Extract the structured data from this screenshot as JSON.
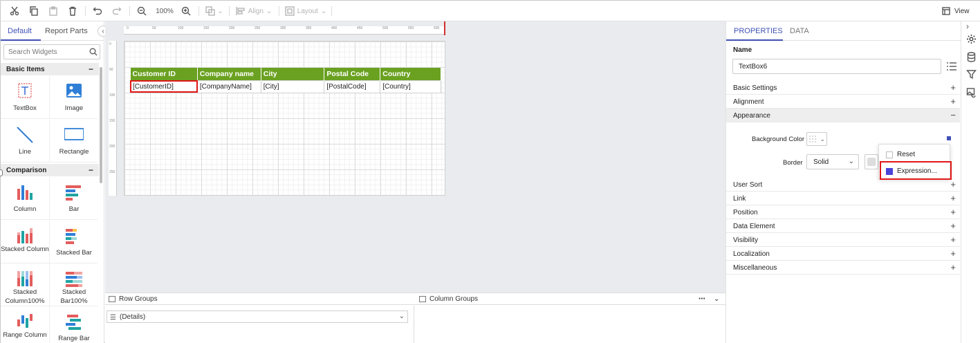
{
  "toolbar": {
    "zoom": "100%",
    "align_label": "Align",
    "layout_label": "Layout",
    "view_label": "View"
  },
  "left_panel": {
    "tabs": [
      "Default",
      "Report Parts"
    ],
    "search_placeholder": "Search Widgets",
    "categories": {
      "basic": "Basic Items",
      "comparison": "Comparison"
    },
    "widgets": {
      "textbox": "TextBox",
      "image": "Image",
      "line": "Line",
      "rectangle": "Rectangle",
      "column": "Column",
      "bar": "Bar",
      "stacked_column": "Stacked Column",
      "stacked_bar": "Stacked Bar",
      "stacked_column100": "Stacked Column100%",
      "stacked_bar100": "Stacked Bar100%",
      "range_column": "Range Column",
      "range_bar": "Range Bar"
    }
  },
  "canvas": {
    "ruler_h": [
      "0",
      "50",
      "100",
      "150",
      "200",
      "250",
      "300",
      "350",
      "400",
      "450",
      "500",
      "550",
      "600"
    ],
    "ruler_v": [
      "0",
      "50",
      "100",
      "150",
      "200",
      "250"
    ],
    "table": {
      "headers": [
        "Customer ID",
        "Company name",
        "City",
        "Postal Code",
        "Country"
      ],
      "row": [
        "[CustomerID]",
        "[CompanyName]",
        "[City]",
        "[PostalCode]",
        "[Country]"
      ]
    },
    "header_color": "#6aa121"
  },
  "groups": {
    "row_groups": "Row Groups",
    "column_groups": "Column Groups",
    "row_group_item": "(Details)"
  },
  "right_panel": {
    "tabs": [
      "PROPERTIES",
      "DATA"
    ],
    "name_label": "Name",
    "name_value": "TextBox6",
    "sections": {
      "basic": "Basic Settings",
      "alignment": "Alignment",
      "appearance": "Appearance",
      "user_sort": "User Sort",
      "link": "Link",
      "position": "Position",
      "data_element": "Data Element",
      "visibility": "Visibility",
      "localization": "Localization",
      "misc": "Miscellaneous"
    },
    "background_color_label": "Background Color",
    "border_label": "Border",
    "border_value": "Solid",
    "popup": {
      "reset": "Reset",
      "expression": "Expression..."
    },
    "accent": "#3f51b5"
  }
}
